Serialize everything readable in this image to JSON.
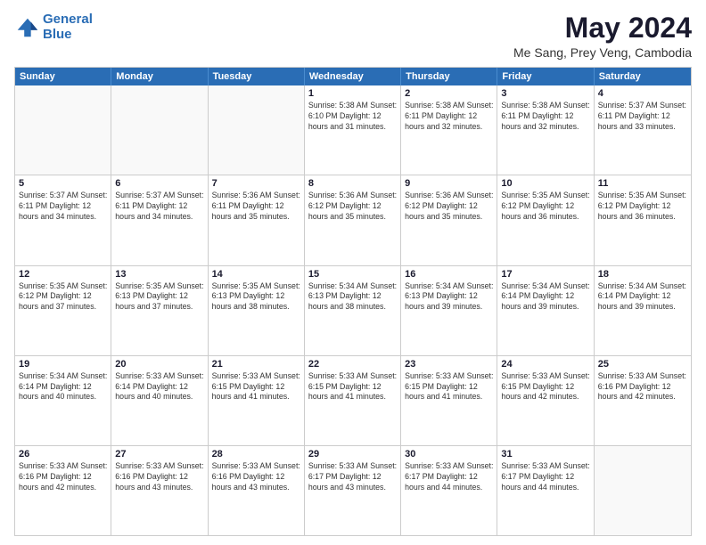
{
  "logo": {
    "line1": "General",
    "line2": "Blue"
  },
  "title": "May 2024",
  "subtitle": "Me Sang, Prey Veng, Cambodia",
  "header_days": [
    "Sunday",
    "Monday",
    "Tuesday",
    "Wednesday",
    "Thursday",
    "Friday",
    "Saturday"
  ],
  "weeks": [
    [
      {
        "day": "",
        "info": ""
      },
      {
        "day": "",
        "info": ""
      },
      {
        "day": "",
        "info": ""
      },
      {
        "day": "1",
        "info": "Sunrise: 5:38 AM\nSunset: 6:10 PM\nDaylight: 12 hours\nand 31 minutes."
      },
      {
        "day": "2",
        "info": "Sunrise: 5:38 AM\nSunset: 6:11 PM\nDaylight: 12 hours\nand 32 minutes."
      },
      {
        "day": "3",
        "info": "Sunrise: 5:38 AM\nSunset: 6:11 PM\nDaylight: 12 hours\nand 32 minutes."
      },
      {
        "day": "4",
        "info": "Sunrise: 5:37 AM\nSunset: 6:11 PM\nDaylight: 12 hours\nand 33 minutes."
      }
    ],
    [
      {
        "day": "5",
        "info": "Sunrise: 5:37 AM\nSunset: 6:11 PM\nDaylight: 12 hours\nand 34 minutes."
      },
      {
        "day": "6",
        "info": "Sunrise: 5:37 AM\nSunset: 6:11 PM\nDaylight: 12 hours\nand 34 minutes."
      },
      {
        "day": "7",
        "info": "Sunrise: 5:36 AM\nSunset: 6:11 PM\nDaylight: 12 hours\nand 35 minutes."
      },
      {
        "day": "8",
        "info": "Sunrise: 5:36 AM\nSunset: 6:12 PM\nDaylight: 12 hours\nand 35 minutes."
      },
      {
        "day": "9",
        "info": "Sunrise: 5:36 AM\nSunset: 6:12 PM\nDaylight: 12 hours\nand 35 minutes."
      },
      {
        "day": "10",
        "info": "Sunrise: 5:35 AM\nSunset: 6:12 PM\nDaylight: 12 hours\nand 36 minutes."
      },
      {
        "day": "11",
        "info": "Sunrise: 5:35 AM\nSunset: 6:12 PM\nDaylight: 12 hours\nand 36 minutes."
      }
    ],
    [
      {
        "day": "12",
        "info": "Sunrise: 5:35 AM\nSunset: 6:12 PM\nDaylight: 12 hours\nand 37 minutes."
      },
      {
        "day": "13",
        "info": "Sunrise: 5:35 AM\nSunset: 6:13 PM\nDaylight: 12 hours\nand 37 minutes."
      },
      {
        "day": "14",
        "info": "Sunrise: 5:35 AM\nSunset: 6:13 PM\nDaylight: 12 hours\nand 38 minutes."
      },
      {
        "day": "15",
        "info": "Sunrise: 5:34 AM\nSunset: 6:13 PM\nDaylight: 12 hours\nand 38 minutes."
      },
      {
        "day": "16",
        "info": "Sunrise: 5:34 AM\nSunset: 6:13 PM\nDaylight: 12 hours\nand 39 minutes."
      },
      {
        "day": "17",
        "info": "Sunrise: 5:34 AM\nSunset: 6:14 PM\nDaylight: 12 hours\nand 39 minutes."
      },
      {
        "day": "18",
        "info": "Sunrise: 5:34 AM\nSunset: 6:14 PM\nDaylight: 12 hours\nand 39 minutes."
      }
    ],
    [
      {
        "day": "19",
        "info": "Sunrise: 5:34 AM\nSunset: 6:14 PM\nDaylight: 12 hours\nand 40 minutes."
      },
      {
        "day": "20",
        "info": "Sunrise: 5:33 AM\nSunset: 6:14 PM\nDaylight: 12 hours\nand 40 minutes."
      },
      {
        "day": "21",
        "info": "Sunrise: 5:33 AM\nSunset: 6:15 PM\nDaylight: 12 hours\nand 41 minutes."
      },
      {
        "day": "22",
        "info": "Sunrise: 5:33 AM\nSunset: 6:15 PM\nDaylight: 12 hours\nand 41 minutes."
      },
      {
        "day": "23",
        "info": "Sunrise: 5:33 AM\nSunset: 6:15 PM\nDaylight: 12 hours\nand 41 minutes."
      },
      {
        "day": "24",
        "info": "Sunrise: 5:33 AM\nSunset: 6:15 PM\nDaylight: 12 hours\nand 42 minutes."
      },
      {
        "day": "25",
        "info": "Sunrise: 5:33 AM\nSunset: 6:16 PM\nDaylight: 12 hours\nand 42 minutes."
      }
    ],
    [
      {
        "day": "26",
        "info": "Sunrise: 5:33 AM\nSunset: 6:16 PM\nDaylight: 12 hours\nand 42 minutes."
      },
      {
        "day": "27",
        "info": "Sunrise: 5:33 AM\nSunset: 6:16 PM\nDaylight: 12 hours\nand 43 minutes."
      },
      {
        "day": "28",
        "info": "Sunrise: 5:33 AM\nSunset: 6:16 PM\nDaylight: 12 hours\nand 43 minutes."
      },
      {
        "day": "29",
        "info": "Sunrise: 5:33 AM\nSunset: 6:17 PM\nDaylight: 12 hours\nand 43 minutes."
      },
      {
        "day": "30",
        "info": "Sunrise: 5:33 AM\nSunset: 6:17 PM\nDaylight: 12 hours\nand 44 minutes."
      },
      {
        "day": "31",
        "info": "Sunrise: 5:33 AM\nSunset: 6:17 PM\nDaylight: 12 hours\nand 44 minutes."
      },
      {
        "day": "",
        "info": ""
      }
    ]
  ]
}
